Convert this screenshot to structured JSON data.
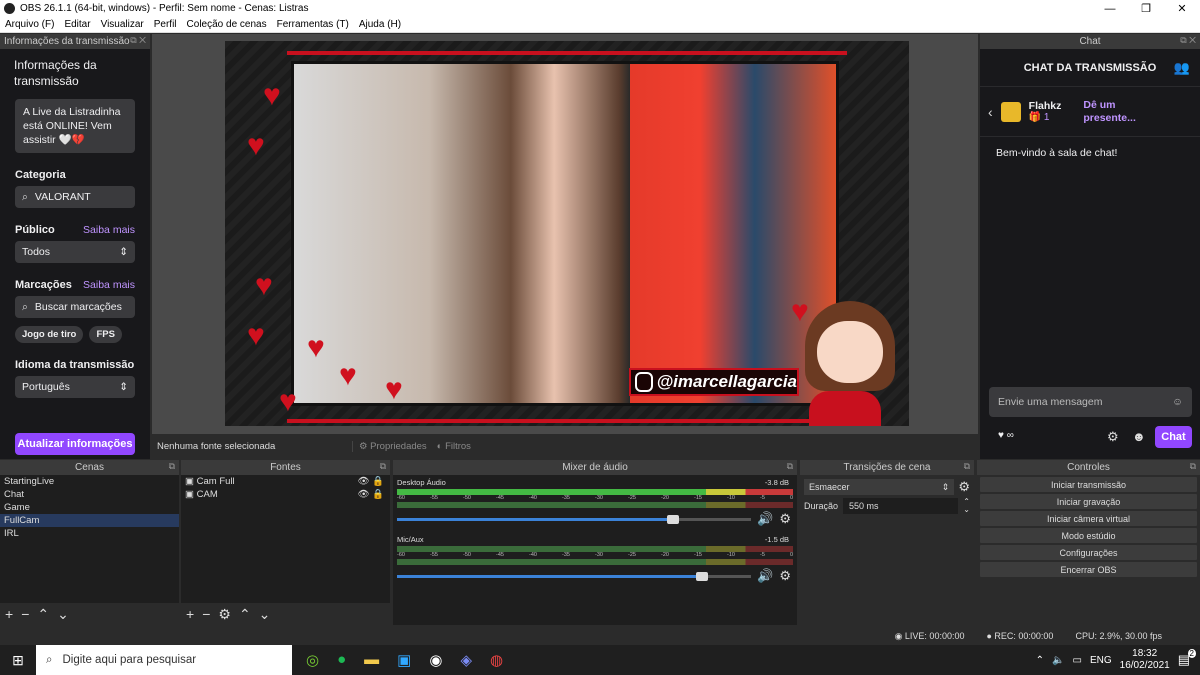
{
  "window": {
    "title": "OBS 26.1.1 (64-bit, windows) - Perfil: Sem nome - Cenas: Listras",
    "minimize": "—",
    "maximize": "❐",
    "close": "✕"
  },
  "menu": [
    "Arquivo (F)",
    "Editar",
    "Visualizar",
    "Perfil",
    "Coleção de cenas",
    "Ferramentas (T)",
    "Ajuda (H)"
  ],
  "stream_info": {
    "dock_title": "Informações da transmissão",
    "heading": "Informações da transmissão",
    "notice": "A Live da Listradinha está ONLINE! Vem assistir 🤍💔",
    "category_label": "Categoria",
    "category_value": "VALORANT",
    "audience_label": "Público",
    "audience_more": "Saiba mais",
    "audience_value": "Todos",
    "tags_label": "Marcações",
    "tags_more": "Saiba mais",
    "tags_placeholder": "Buscar marcações",
    "tags": [
      "Jogo de tiro",
      "FPS"
    ],
    "language_label": "Idioma da transmissão",
    "language_value": "Português",
    "update_button": "Atualizar informações"
  },
  "preview": {
    "handle": "@imarcellagarcia",
    "no_source": "Nenhuma fonte selecionada",
    "properties": "Propriedades",
    "filters": "Filtros",
    "accent": "#d0101e"
  },
  "chat": {
    "dock_title": "Chat",
    "heading": "CHAT DA TRANSMISSÃO",
    "gifter_name": "Flahkz",
    "gifter_count": "1",
    "gift_prompt": "Dê um presente...",
    "welcome": "Bem-vindo à sala de chat!",
    "input_placeholder": "Envie uma mensagem",
    "points": "∞",
    "send_button": "Chat"
  },
  "scenes": {
    "title": "Cenas",
    "items": [
      "StartingLive",
      "Chat",
      "Game",
      "FullCam",
      "IRL"
    ],
    "selected": "FullCam"
  },
  "sources": {
    "title": "Fontes",
    "items": [
      "Cam Full",
      "CAM"
    ]
  },
  "mixer": {
    "title": "Mixer de áudio",
    "scale": [
      "-60",
      "-55",
      "-50",
      "-45",
      "-40",
      "-35",
      "-30",
      "-25",
      "-20",
      "-15",
      "-10",
      "-5",
      "0"
    ],
    "channels": [
      {
        "name": "Desktop Áudio",
        "db": "-3.8 dB",
        "level": 0.78
      },
      {
        "name": "Mic/Aux",
        "db": "-1.5 dB",
        "level": 0.86
      }
    ]
  },
  "transitions": {
    "title": "Transições de cena",
    "type": "Esmaecer",
    "duration_label": "Duração",
    "duration_value": "550 ms"
  },
  "controls": {
    "title": "Controles",
    "buttons": [
      "Iniciar transmissão",
      "Iniciar gravação",
      "Iniciar câmera virtual",
      "Modo estúdio",
      "Configurações",
      "Encerrar OBS"
    ]
  },
  "status": {
    "live": "LIVE: 00:00:00",
    "rec": "REC: 00:00:00",
    "cpu": "CPU: 2.9%, 30.00 fps"
  },
  "taskbar": {
    "search_placeholder": "Digite aqui para pesquisar",
    "lang": "ENG",
    "time": "18:32",
    "date": "16/02/2021",
    "notif_count": "2"
  }
}
